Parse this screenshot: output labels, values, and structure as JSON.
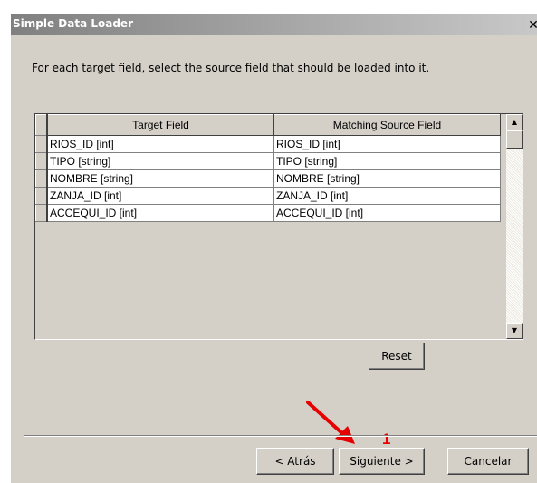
{
  "window": {
    "title": "Simple Data Loader",
    "close_glyph": "✕"
  },
  "instruction": "For each target field, select the source field that should be loaded into it.",
  "table": {
    "columns": [
      "Target Field",
      "Matching Source Field"
    ],
    "rows": [
      [
        "RIOS_ID [int]",
        "RIOS_ID [int]"
      ],
      [
        "TIPO [string]",
        "TIPO [string]"
      ],
      [
        "NOMBRE [string]",
        "NOMBRE [string]"
      ],
      [
        "ZANJA_ID [int]",
        "ZANJA_ID [int]"
      ],
      [
        "ACCEQUI_ID [int]",
        "ACCEQUI_ID [int]"
      ]
    ]
  },
  "buttons": {
    "reset": "Reset",
    "back": "< Atrás",
    "next": "Siguiente >",
    "cancel": "Cancelar"
  },
  "annotation": {
    "label": "1",
    "color": "#e60000"
  },
  "icons": {
    "scroll_up": "scroll-up-icon",
    "scroll_down": "scroll-down-icon",
    "close": "close-icon"
  }
}
